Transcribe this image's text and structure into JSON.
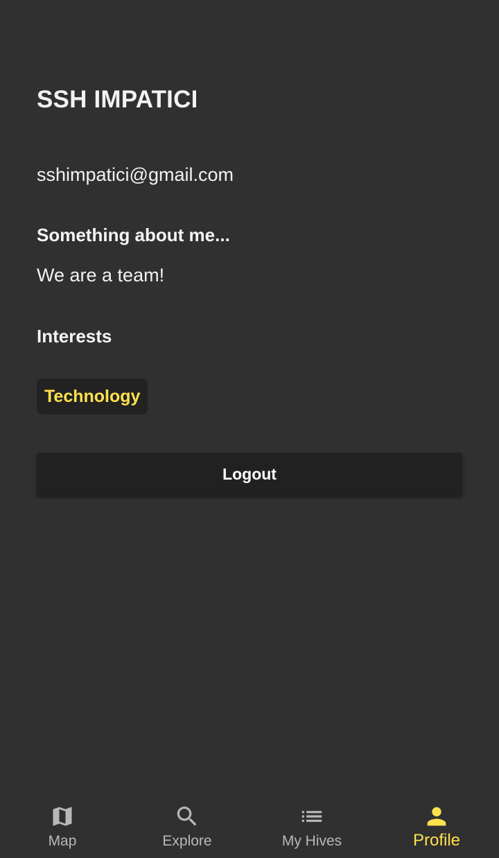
{
  "profile": {
    "name": "SSH IMPATICI",
    "email": "sshimpatici@gmail.com",
    "about_heading": "Something about me...",
    "about_text": "We are a team!",
    "interests_heading": "Interests",
    "interests": [
      "Technology"
    ],
    "logout_label": "Logout"
  },
  "bottom_nav": {
    "items": [
      {
        "label": "Map",
        "icon": "map-icon",
        "active": false
      },
      {
        "label": "Explore",
        "icon": "search-icon",
        "active": false
      },
      {
        "label": "My Hives",
        "icon": "list-icon",
        "active": false
      },
      {
        "label": "Profile",
        "icon": "person-icon",
        "active": true
      }
    ]
  },
  "colors": {
    "background": "#303030",
    "surface": "#212121",
    "accent": "#ffe14d",
    "inactive": "#b8b8b8"
  }
}
